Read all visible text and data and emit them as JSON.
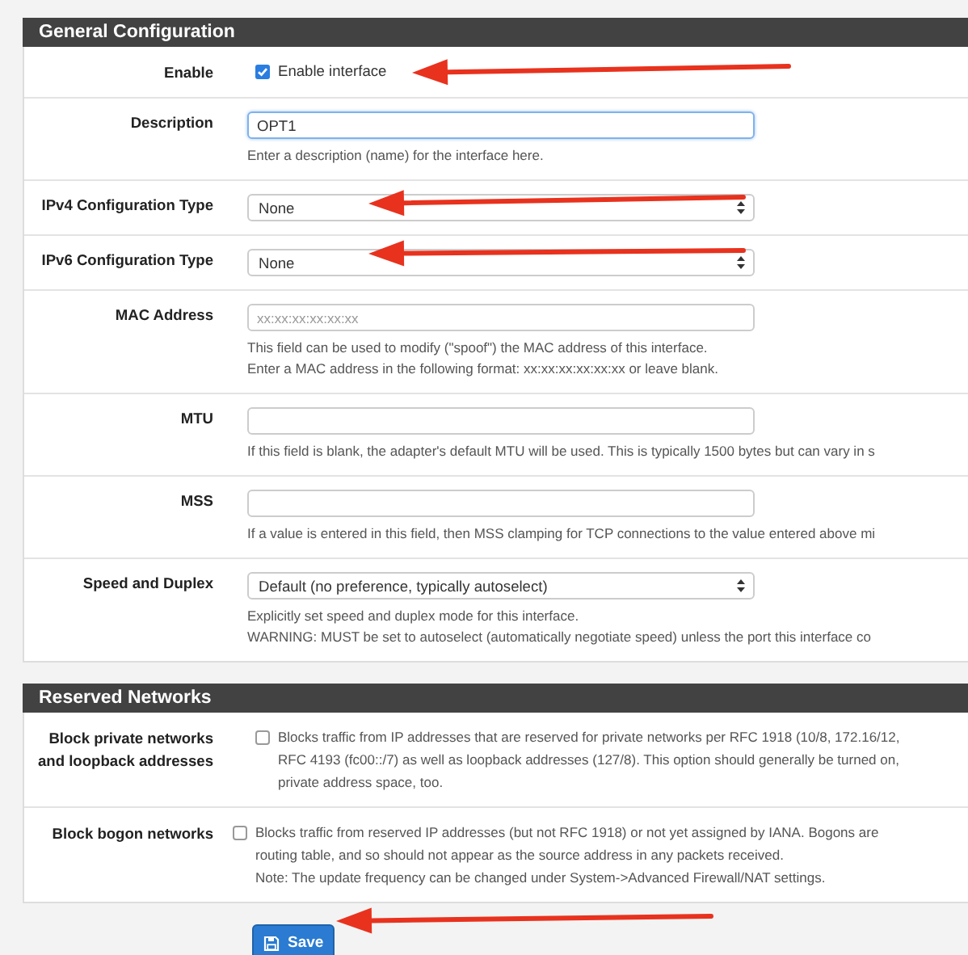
{
  "sections": [
    {
      "title": "General Configuration",
      "rows": [
        {
          "kind": "checkbox",
          "label": "Enable",
          "checked": true,
          "text": "Enable interface"
        },
        {
          "kind": "text",
          "label": "Description",
          "value": "OPT1",
          "focused": true,
          "help": [
            "Enter a description (name) for the interface here."
          ]
        },
        {
          "kind": "select",
          "label": "IPv4 Configuration Type",
          "value": "None"
        },
        {
          "kind": "select",
          "label": "IPv6 Configuration Type",
          "value": "None"
        },
        {
          "kind": "text",
          "label": "MAC Address",
          "placeholder": "xx:xx:xx:xx:xx:xx",
          "focused": false,
          "help": [
            "This field can be used to modify (\"spoof\") the MAC address of this interface.",
            "Enter a MAC address in the following format: xx:xx:xx:xx:xx:xx or leave blank."
          ]
        },
        {
          "kind": "text",
          "label": "MTU",
          "focused": false,
          "help": [
            "If this field is blank, the adapter's default MTU will be used. This is typically 1500 bytes but can vary in s"
          ]
        },
        {
          "kind": "text",
          "label": "MSS",
          "focused": false,
          "help": [
            "If a value is entered in this field, then MSS clamping for TCP connections to the value entered above mi"
          ]
        },
        {
          "kind": "select",
          "label": "Speed and Duplex",
          "value": "Default (no preference, typically autoselect)",
          "help": [
            "Explicitly set speed and duplex mode for this interface.",
            "WARNING: MUST be set to autoselect (automatically negotiate speed) unless the port this interface co"
          ]
        }
      ]
    },
    {
      "title": "Reserved Networks",
      "rows": [
        {
          "kind": "checkbox",
          "label": "Block private networks and loopback addresses",
          "checked": false,
          "help": [
            "Blocks traffic from IP addresses that are reserved for private networks per RFC 1918 (10/8, 172.16/12,",
            "RFC 4193 (fc00::/7) as well as loopback addresses (127/8). This option should generally be turned on,",
            "private address space, too."
          ]
        },
        {
          "kind": "checkbox",
          "label": "Block bogon networks",
          "checked": false,
          "help": [
            "Blocks traffic from reserved IP addresses (but not RFC 1918) or not yet assigned by IANA. Bogons are",
            "routing table, and so should not appear as the source address in any packets received.",
            "Note: The update frequency can be changed under System->Advanced Firewall/NAT settings."
          ]
        }
      ]
    }
  ],
  "save_button": "Save"
}
